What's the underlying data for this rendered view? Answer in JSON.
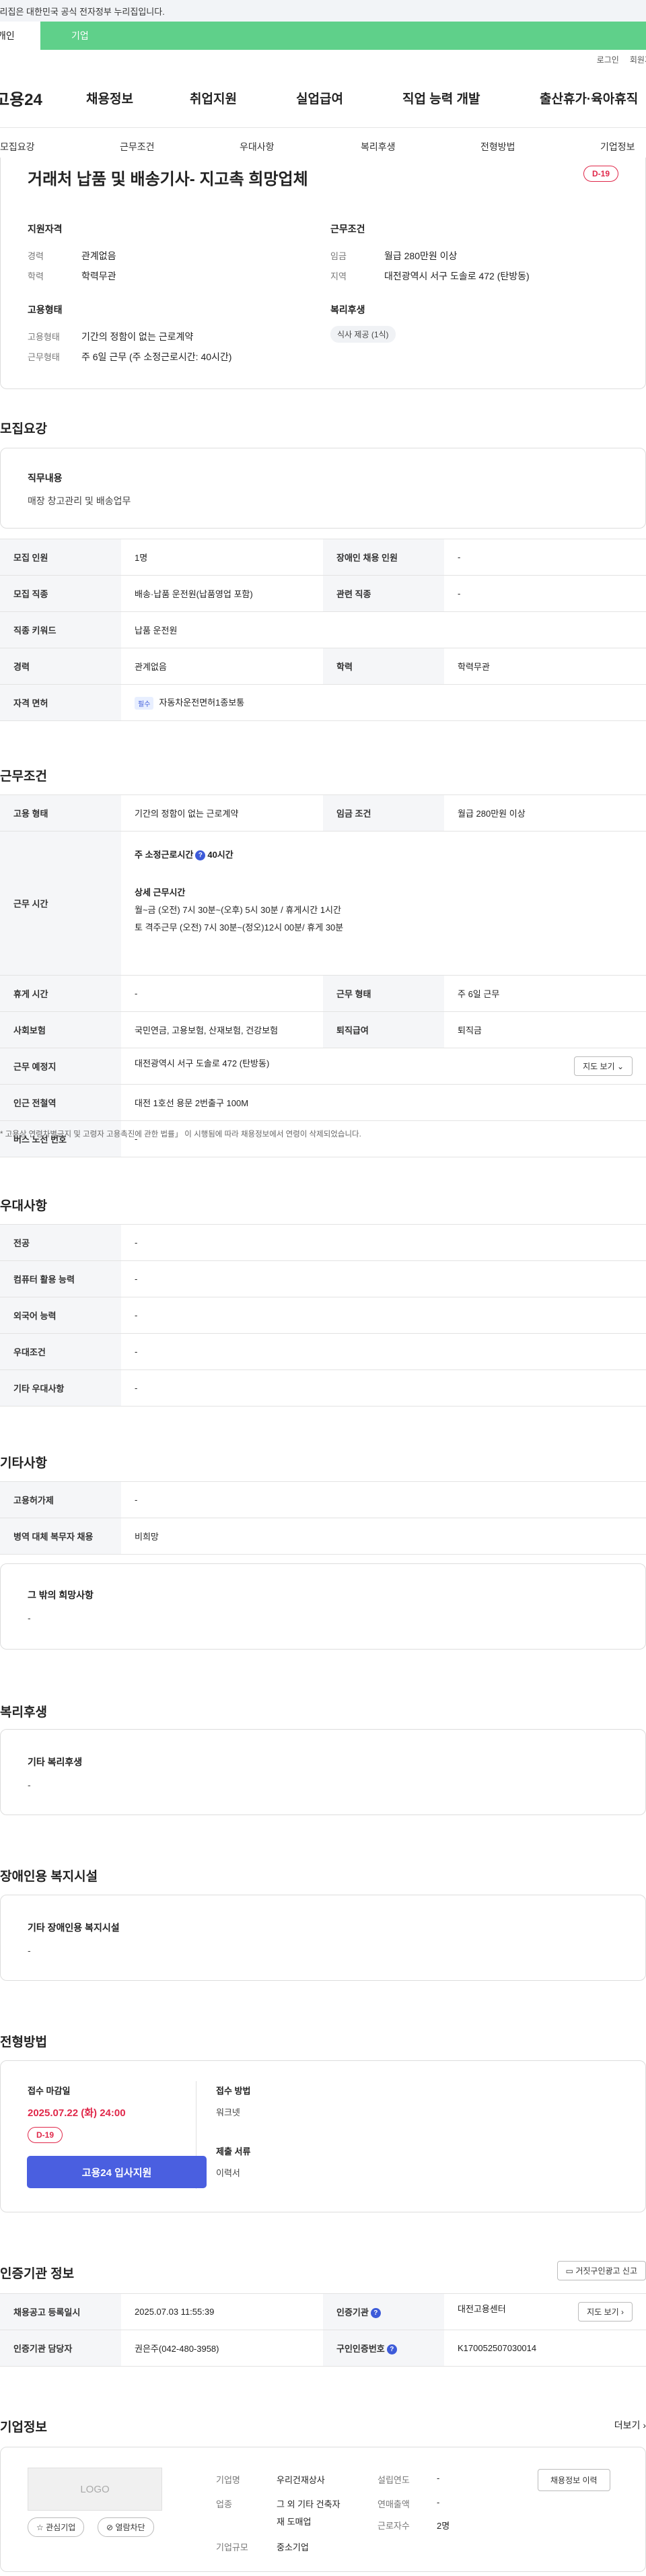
{
  "gov_banner": "이 누리집은 대한민국 공식 전자정부 누리집입니다.",
  "service_tabs": [
    "개인",
    "기업"
  ],
  "util": {
    "login": "로그인",
    "join": "회원가입"
  },
  "logo": "고용24",
  "gnb": [
    "채용정보",
    "취업지원",
    "실업급여",
    "직업 능력 개발",
    "출산휴가·육아휴직"
  ],
  "snb": [
    "모집요강",
    "근무조건",
    "우대사항",
    "복리후생",
    "전형방법",
    "기업정보"
  ],
  "job": {
    "title": "거래처 납품 및 배송기사- 지고촉 희망업체",
    "dday": "D-19",
    "qual_label": "지원자격",
    "career_k": "경력",
    "career_v": "관계없음",
    "edu_k": "학력",
    "edu_v": "학력무관",
    "emp_label": "고용형태",
    "emp_k": "고용형태",
    "emp_v": "기간의 정함이 없는 근로계약",
    "work_k": "근무형태",
    "work_v": "주 6일 근무 (주 소정근로시간: 40시간)",
    "cond_label": "근무조건",
    "wage_k": "임금",
    "wage_v": "월급 280만원 이상",
    "area_k": "지역",
    "area_v": "대전광역시 서구 도솔로 472 (탄방동)",
    "welfare_label": "복리후생",
    "welfare_chip": "식사 제공 (1식)"
  },
  "recruit": {
    "heading": "모집요강",
    "duty_label": "직무내용",
    "duty_text": "매장 창고관리 및 배송업무",
    "rows": {
      "count_k": "모집 인원",
      "count_v": "1명",
      "disab_k": "장애인 채용 인원",
      "disab_v": "-",
      "job_k": "모집 직종",
      "job_v": "배송·납품 운전원(납품영업 포함)",
      "related_k": "관련 직종",
      "related_v": "-",
      "keyword_k": "직종 키워드",
      "keyword_v": "납품 운전원",
      "career_k": "경력",
      "career_v": "관계없음",
      "edu_k": "학력",
      "edu_v": "학력무관",
      "license_k": "자격 면허",
      "license_badge": "필수",
      "license_v": "자동차운전면허1종보통"
    }
  },
  "work": {
    "heading": "근무조건",
    "type_k": "고용 형태",
    "type_v": "기간의 정함이 없는 근로계약",
    "wage_k": "임금 조건",
    "wage_v": "월급 280만원 이상",
    "hours_k": "근무 시간",
    "hours_main": "주 소정근로시간",
    "hours_q": "?",
    "hours_value": "40시간",
    "hours_detail_label": "상세 근무시간",
    "hours_detail1": "월~금 (오전) 7시 30분~(오후) 5시 30분 / 휴게시간 1시간",
    "hours_detail2": "토 격주근무 (오전) 7시 30분~(정오)12시 00분/ 휴게 30분",
    "break_k": "휴게 시간",
    "break_v": "-",
    "shift_k": "근무 형태",
    "shift_v": "주 6일 근무",
    "ins_k": "사회보험",
    "ins_v": "국민연금, 고용보험, 산재보험, 건강보험",
    "sev_k": "퇴직급여",
    "sev_v": "퇴직금",
    "place_k": "근무 예정지",
    "place_v": "대전광역시 서구 도솔로 472 (탄방동)",
    "map_btn": "지도 보기",
    "station_k": "인근 전철역",
    "station_v": "대전 1호선 용문 2번출구 100M",
    "bus_k": "버스 노선 번호",
    "bus_v": "-",
    "note": "* 고용상 연령차별금지 및 고령자 고용촉진에 관한 법률」 이 시행됨에 따라 채용정보에서 연령이 삭제되었습니다."
  },
  "pref": {
    "heading": "우대사항",
    "rows": [
      {
        "k": "전공",
        "v": "-"
      },
      {
        "k": "컴퓨터 활용 능력",
        "v": "-"
      },
      {
        "k": "외국어 능력",
        "v": "-"
      },
      {
        "k": "우대조건",
        "v": "-"
      },
      {
        "k": "기타 우대사항",
        "v": "-"
      }
    ]
  },
  "etc": {
    "heading": "기타사항",
    "rows": [
      {
        "k": "고용허가제",
        "v": "-"
      },
      {
        "k": "병역 대체 복무자 채용",
        "v": "비희망"
      }
    ],
    "box_label": "그 밖의 희망사항",
    "box_text": "-"
  },
  "benefit": {
    "heading": "복리후생",
    "box_label": "기타 복리후생",
    "box_text": "-"
  },
  "disab": {
    "heading": "장애인용 복지시설",
    "box_label": "기타 장애인용 복지시설",
    "box_text": "-"
  },
  "apply": {
    "heading": "전형방법",
    "deadline_label": "접수 마감일",
    "deadline": "2025.07.22 (화) 24:00",
    "dday": "D-19",
    "apply_btn": "고용24 입사지원",
    "method_label": "접수 방법",
    "method_v": "워크넷",
    "docs_label": "제출 서류",
    "docs_v": "이력서"
  },
  "org": {
    "heading": "인증기관 정보",
    "report_btn": "거짓구인광고 신고",
    "reg_k": "채용공고 등록일시",
    "reg_v": "2025.07.03 11:55:39",
    "org_k": "인증기관",
    "org_v": "대전고용센터",
    "map_btn": "지도 보기",
    "mgr_k": "인증기관 담당자",
    "mgr_v": "권은주(042-480-3958)",
    "no_k": "구인인증번호",
    "no_v": "K170052507030014"
  },
  "company": {
    "heading": "기업정보",
    "more": "더보기",
    "logo_text": "LOGO",
    "fav_btn": "관심기업",
    "block_btn": "열람차단",
    "name_k": "기업명",
    "name_v": "우리건재상사",
    "biz_k": "업종",
    "biz_v1": "그 외 기타 건축자",
    "biz_v2": "재 도매업",
    "size_k": "기업규모",
    "size_v": "중소기업",
    "est_k": "설립연도",
    "est_v": "-",
    "sales_k": "연매출액",
    "sales_v": "-",
    "emp_k": "근로자수",
    "emp_v": "2명",
    "history_btn": "채용정보 이력"
  }
}
